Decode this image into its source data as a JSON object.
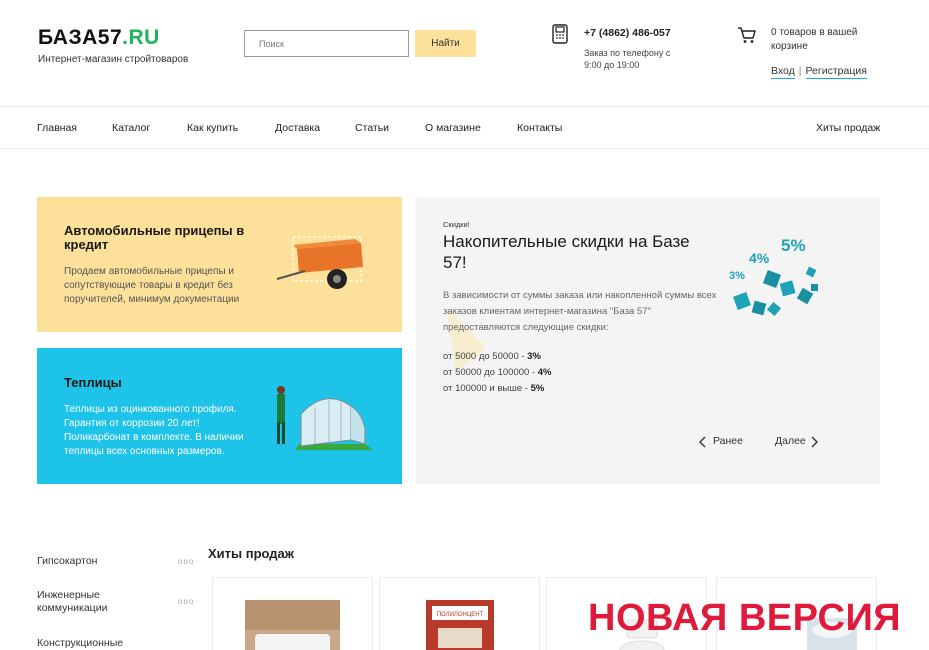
{
  "header": {
    "logo_main": "БАЗА57",
    "logo_suffix": ".RU",
    "tagline": "Интернет-магазин стройтоваров",
    "search_placeholder": "Поиск",
    "search_button": "Найти",
    "phone": "+7 (4862) 486-057",
    "phone_note": "Заказ по телефону с 9:00 до 19:00",
    "cart_count": "0 товаров в вашей корзине",
    "login": "Вход",
    "separator": "|",
    "register": "Регистрация"
  },
  "nav": {
    "items": [
      "Главная",
      "Каталог",
      "Как купить",
      "Доставка",
      "Статьи",
      "О магазине",
      "Контакты"
    ],
    "right": "Хиты продаж"
  },
  "cards": {
    "trailers": {
      "title": "Автомобильные прицепы в кредит",
      "text": "Продаем автомобильные прицепы и сопутствующие товары в кредит без поручителей, минимум документации"
    },
    "greenhouses": {
      "title": "Теплицы",
      "text": "Теплицы из оцинкованного профиля. Гарантия от коррозии 20 лет! Поликарбонат в комплекте. В наличии теплицы всех основных размеров."
    }
  },
  "promo": {
    "label": "Скидки!",
    "title": "Накопительные скидки на Базе 57!",
    "description": "В зависимости от суммы заказа или накопленной суммы всех заказов клиентам интернет-магазина \"База 57\" предоставляются следующие скидки:",
    "tiers": [
      {
        "range": "от 5000 до 50000 - ",
        "discount": "3%"
      },
      {
        "range": "от 50000 до 100000 - ",
        "discount": "4%"
      },
      {
        "range": "от 100000 и выше - ",
        "discount": "5%"
      }
    ],
    "dice_labels": [
      "5%",
      "4%",
      "3%"
    ],
    "prev": "Ранее",
    "next": "Далее"
  },
  "sidebar": {
    "items": [
      "Гипсокартон",
      "Инженерные коммуникации",
      "Конструкционные"
    ],
    "more": "ooo"
  },
  "hits": {
    "title": "Хиты продаж",
    "product_label": "ПОЛИЛОНЦЕНТ"
  },
  "overlay": {
    "badge": "НОВАЯ ВЕРСИЯ"
  },
  "colors": {
    "accent_green": "#1fb45a",
    "yellow_card": "#fde19a",
    "blue_card": "#1ec3ea",
    "dice_teal": "#1da3b8",
    "badge_red": "#e01a3a"
  }
}
